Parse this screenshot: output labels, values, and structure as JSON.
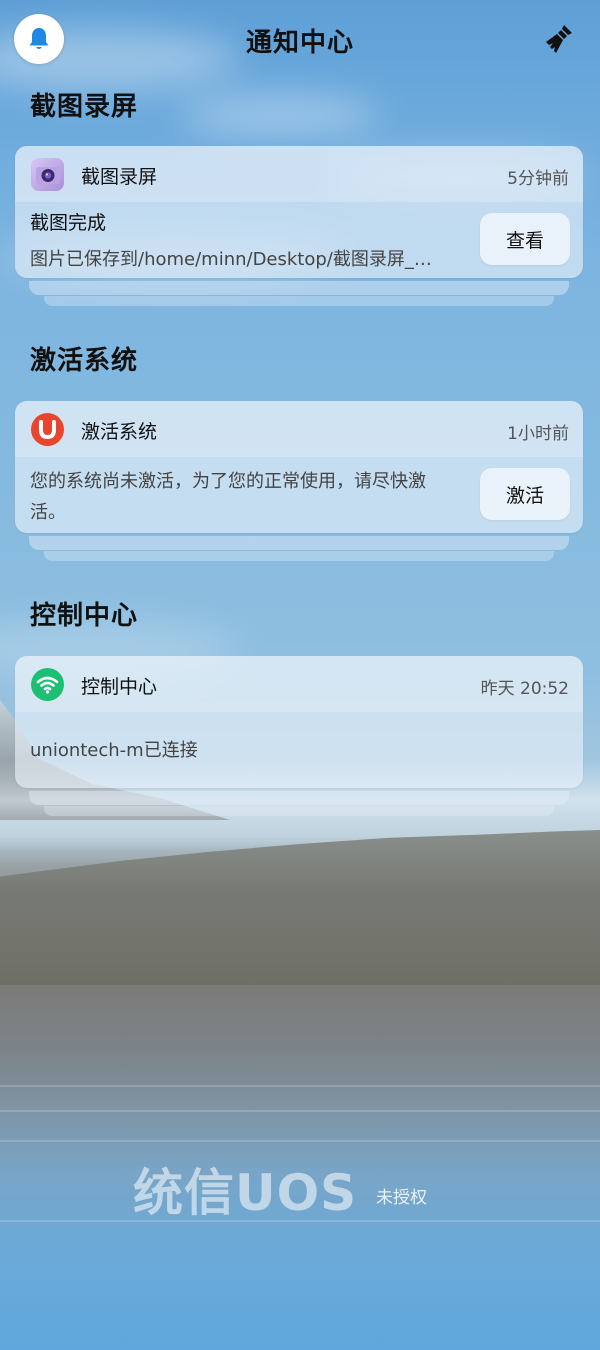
{
  "header": {
    "title": "通知中心",
    "bell_icon": "bell-icon",
    "clear_icon": "broom-icon"
  },
  "groups": [
    {
      "title": "截图录屏",
      "notification": {
        "app_name": "截图录屏",
        "app_icon": "camera-icon",
        "time": "5分钟前",
        "title": "截图完成",
        "body": "图片已保存到/home/minn/Desktop/截图录屏_…",
        "action": "查看"
      }
    },
    {
      "title": "激活系统",
      "notification": {
        "app_name": "激活系统",
        "app_icon": "uos-activation-icon",
        "time": "1小时前",
        "body_line1": "您的系统尚未激活，为了您的正常使用，请尽快激",
        "body_line2": "活。",
        "action": "激活"
      }
    },
    {
      "title": "控制中心",
      "notification": {
        "app_name": "控制中心",
        "app_icon": "wifi-icon",
        "time": "昨天 20:52",
        "body": "uniontech-m已连接"
      }
    }
  ],
  "watermark": {
    "logo": "统信UOS",
    "status": "未授权"
  },
  "colors": {
    "bell_blue": "#1e88e5",
    "activation_red": "#e8452c",
    "wifi_green": "#1dbf73",
    "camera_purple": "#a98ed6"
  }
}
